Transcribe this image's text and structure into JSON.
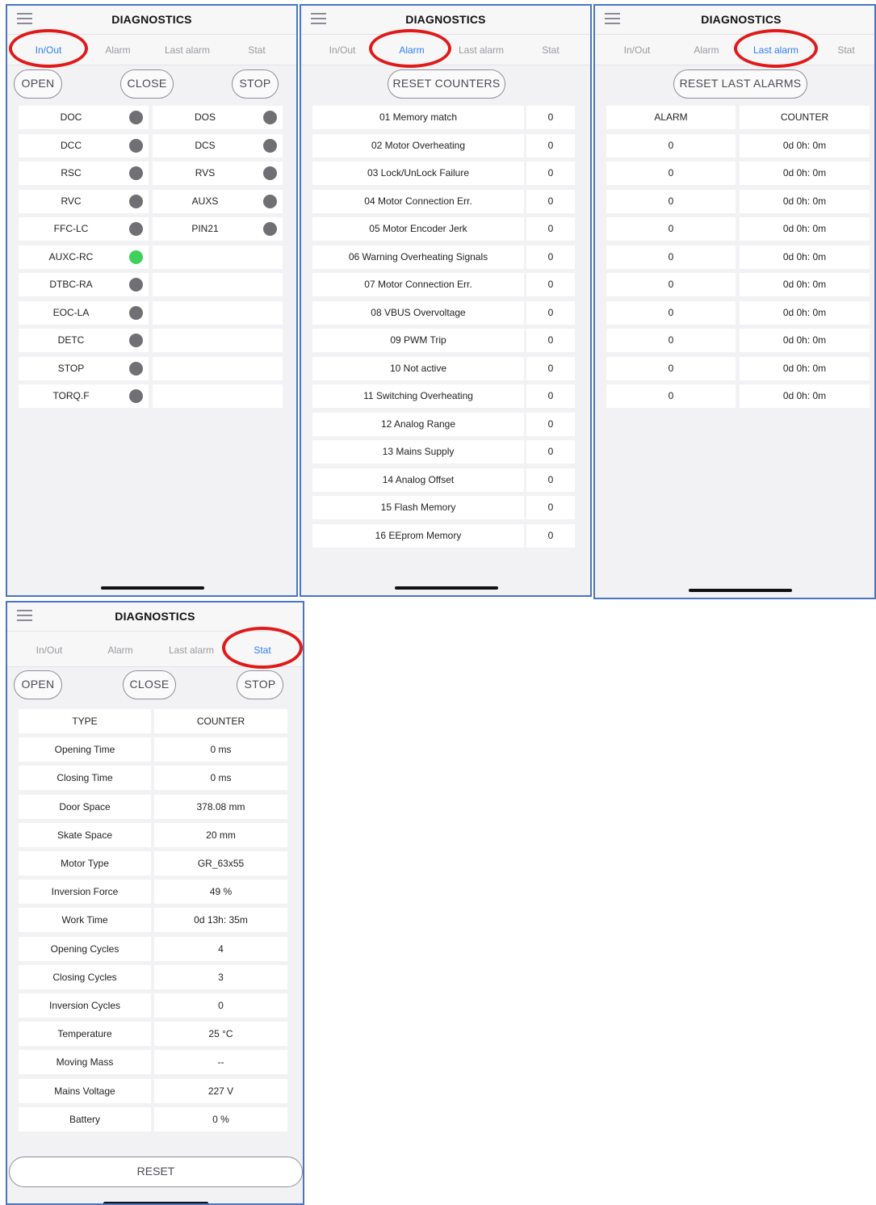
{
  "app": {
    "title": "DIAGNOSTICS"
  },
  "tabs": [
    "In/Out",
    "Alarm",
    "Last alarm",
    "Stat"
  ],
  "colors": {
    "highlight_circle": "#e01a1a",
    "active_tab": "#2f7ff2",
    "indicator_on": "#3fd15b",
    "indicator_off": "#707074",
    "frame_border": "#4a74c4"
  },
  "inout": {
    "buttons": {
      "open": "OPEN",
      "close": "CLOSE",
      "stop": "STOP"
    },
    "left": [
      {
        "label": "DOC",
        "state": "off"
      },
      {
        "label": "DCC",
        "state": "off"
      },
      {
        "label": "RSC",
        "state": "off"
      },
      {
        "label": "RVC",
        "state": "off"
      },
      {
        "label": "FFC-LC",
        "state": "off"
      },
      {
        "label": "AUXC-RC",
        "state": "on"
      },
      {
        "label": "DTBC-RA",
        "state": "off"
      },
      {
        "label": "EOC-LA",
        "state": "off"
      },
      {
        "label": "DETC",
        "state": "off"
      },
      {
        "label": "STOP",
        "state": "off"
      },
      {
        "label": "TORQ.F",
        "state": "off"
      }
    ],
    "right": [
      {
        "label": "DOS",
        "state": "off"
      },
      {
        "label": "DCS",
        "state": "off"
      },
      {
        "label": "RVS",
        "state": "off"
      },
      {
        "label": "AUXS",
        "state": "off"
      },
      {
        "label": "PIN21",
        "state": "off"
      }
    ]
  },
  "alarm": {
    "reset_label": "RESET COUNTERS",
    "rows": [
      {
        "name": "01 Memory match",
        "count": "0"
      },
      {
        "name": "02 Motor Overheating",
        "count": "0"
      },
      {
        "name": "03 Lock/UnLock Failure",
        "count": "0"
      },
      {
        "name": "04 Motor Connection Err.",
        "count": "0"
      },
      {
        "name": "05 Motor Encoder Jerk",
        "count": "0"
      },
      {
        "name": "06 Warning Overheating Signals",
        "count": "0"
      },
      {
        "name": "07 Motor Connection Err.",
        "count": "0"
      },
      {
        "name": "08 VBUS Overvoltage",
        "count": "0"
      },
      {
        "name": "09 PWM Trip",
        "count": "0"
      },
      {
        "name": "10 Not active",
        "count": "0"
      },
      {
        "name": "11 Switching Overheating",
        "count": "0"
      },
      {
        "name": "12 Analog Range",
        "count": "0"
      },
      {
        "name": "13 Mains Supply",
        "count": "0"
      },
      {
        "name": "14 Analog Offset",
        "count": "0"
      },
      {
        "name": "15 Flash Memory",
        "count": "0"
      },
      {
        "name": "16 EEprom Memory",
        "count": "0"
      }
    ]
  },
  "last_alarm": {
    "reset_label": "RESET LAST ALARMS",
    "headers": [
      "ALARM",
      "COUNTER"
    ],
    "rows": [
      [
        "0",
        "0d 0h: 0m"
      ],
      [
        "0",
        "0d 0h: 0m"
      ],
      [
        "0",
        "0d 0h: 0m"
      ],
      [
        "0",
        "0d 0h: 0m"
      ],
      [
        "0",
        "0d 0h: 0m"
      ],
      [
        "0",
        "0d 0h: 0m"
      ],
      [
        "0",
        "0d 0h: 0m"
      ],
      [
        "0",
        "0d 0h: 0m"
      ],
      [
        "0",
        "0d 0h: 0m"
      ],
      [
        "0",
        "0d 0h: 0m"
      ]
    ]
  },
  "stat": {
    "buttons": {
      "open": "OPEN",
      "close": "CLOSE",
      "stop": "STOP"
    },
    "headers": [
      "TYPE",
      "COUNTER"
    ],
    "rows": [
      [
        "Opening Time",
        "0 ms"
      ],
      [
        "Closing Time",
        "0 ms"
      ],
      [
        "Door Space",
        "378.08 mm"
      ],
      [
        "Skate Space",
        "20 mm"
      ],
      [
        "Motor Type",
        "GR_63x55"
      ],
      [
        "Inversion Force",
        "49 %"
      ],
      [
        "Work Time",
        "0d 13h: 35m"
      ],
      [
        "Opening Cycles",
        "4"
      ],
      [
        "Closing Cycles",
        "3"
      ],
      [
        "Inversion Cycles",
        "0"
      ],
      [
        "Temperature",
        "25 °C"
      ],
      [
        "Moving Mass",
        "--"
      ],
      [
        "Mains Voltage",
        "227 V"
      ],
      [
        "Battery",
        "0 %"
      ]
    ],
    "reset_label": "RESET"
  }
}
